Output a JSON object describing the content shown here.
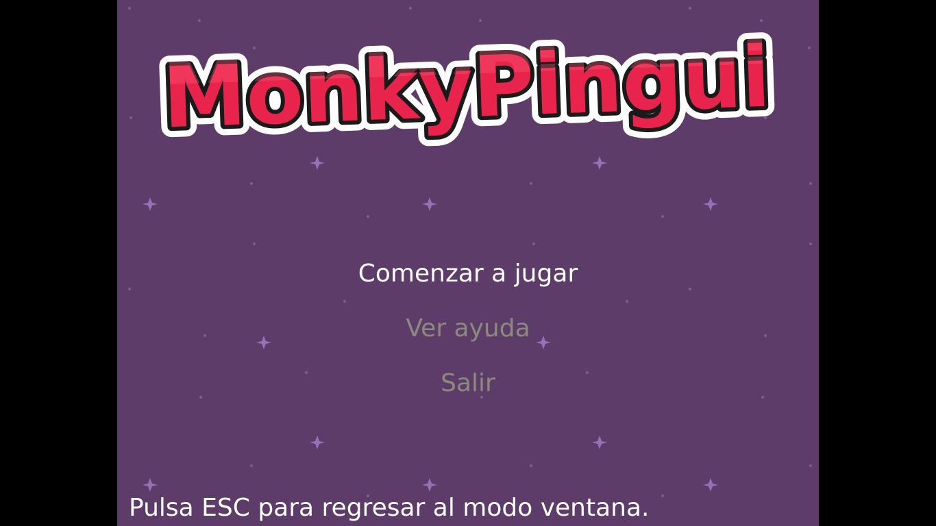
{
  "game": {
    "title": "MonkyPingui",
    "menu": {
      "items": [
        {
          "label": "Comenzar a jugar",
          "selected": true
        },
        {
          "label": "Ver ayuda",
          "selected": false
        },
        {
          "label": "Salir",
          "selected": false
        }
      ]
    },
    "footer_hint": "Pulsa ESC para regresar al modo ventana."
  },
  "colors": {
    "letterbox": "#000000",
    "background": "#5d3c6a",
    "star": "#a57ec8",
    "logo_fill": "#e8244c",
    "logo_outline": "#1a1a1a",
    "logo_border": "#ffffff",
    "menu_selected": "#ffffff",
    "menu_unselected": "#8c8a7d",
    "footer_text": "#ffffff"
  }
}
